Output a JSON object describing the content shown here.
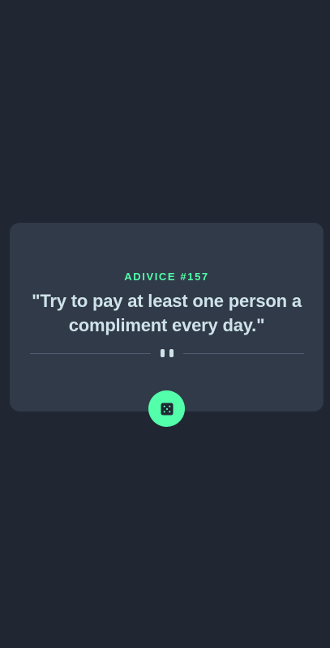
{
  "app": {
    "background_color": "#202632",
    "card_color": "#313a48",
    "accent_color": "#53ffaa",
    "text_color": "#cee3e9"
  },
  "advice": {
    "id_label": "ADIVICE #157",
    "quote": "\"Try to pay at least one person a compliment every day.\""
  },
  "divider": {
    "icon": "pause-icon"
  },
  "actions": {
    "roll_button_icon": "dice-icon"
  }
}
